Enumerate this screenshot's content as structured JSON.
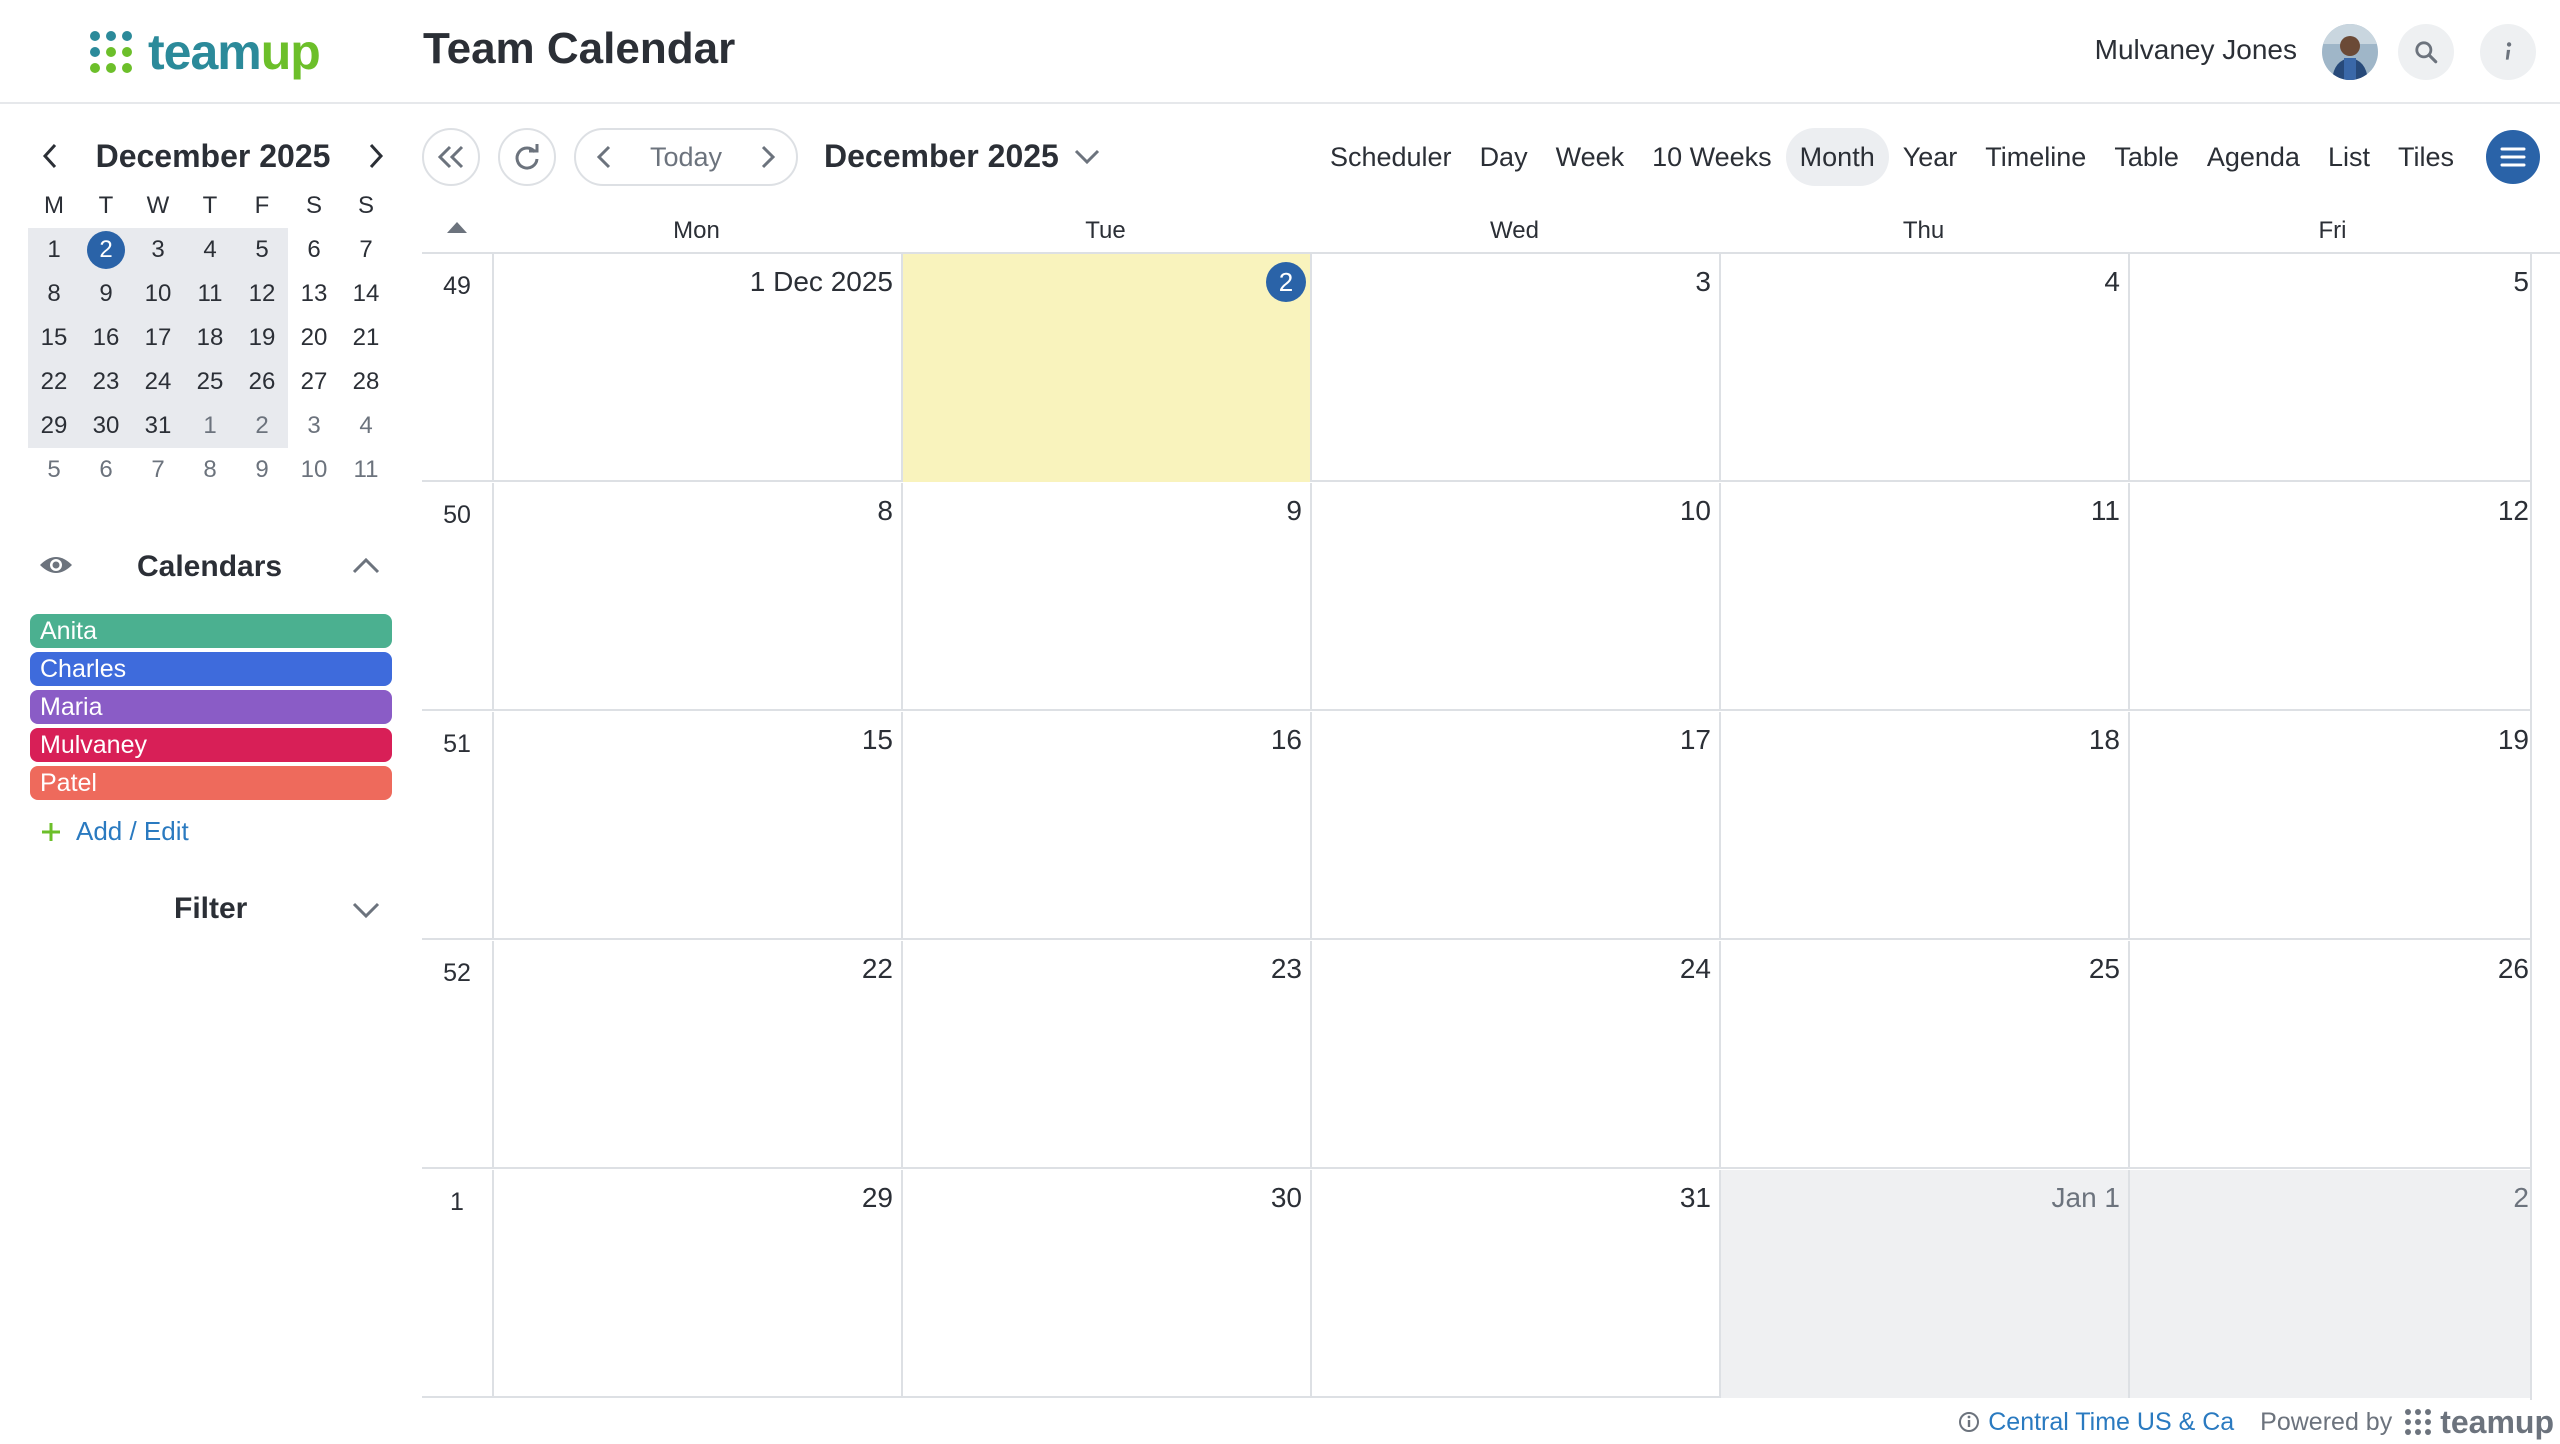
{
  "brand": {
    "name": "teamup",
    "color_team": "#2b8a9a",
    "color_up": "#6cbf2a"
  },
  "header": {
    "title": "Team Calendar",
    "user_name": "Mulvaney Jones",
    "search_icon": "search-icon",
    "info_icon": "info-icon"
  },
  "mini_calendar": {
    "title": "December 2025",
    "weekdays": [
      "M",
      "T",
      "W",
      "T",
      "F",
      "S",
      "S"
    ],
    "weeks": [
      [
        "1",
        "2",
        "3",
        "4",
        "5",
        "6",
        "7"
      ],
      [
        "8",
        "9",
        "10",
        "11",
        "12",
        "13",
        "14"
      ],
      [
        "15",
        "16",
        "17",
        "18",
        "19",
        "20",
        "21"
      ],
      [
        "22",
        "23",
        "24",
        "25",
        "26",
        "27",
        "28"
      ],
      [
        "29",
        "30",
        "31",
        "1",
        "2",
        "3",
        "4"
      ],
      [
        "5",
        "6",
        "7",
        "8",
        "9",
        "10",
        "11"
      ]
    ],
    "selected": "2"
  },
  "calendars": {
    "heading": "Calendars",
    "items": [
      {
        "label": "Anita",
        "color": "#4bb090"
      },
      {
        "label": "Charles",
        "color": "#3e6bdc"
      },
      {
        "label": "Maria",
        "color": "#8a5cc6"
      },
      {
        "label": "Mulvaney",
        "color": "#d81f57"
      },
      {
        "label": "Patel",
        "color": "#ee6a5c"
      }
    ],
    "add_edit": "Add / Edit"
  },
  "filter": {
    "heading": "Filter"
  },
  "toolbar": {
    "today_label": "Today",
    "month_label": "December 2025",
    "views": [
      "Scheduler",
      "Day",
      "Week",
      "10 Weeks",
      "Month",
      "Year",
      "Timeline",
      "Table",
      "Agenda",
      "List",
      "Tiles"
    ],
    "active_view": "Month"
  },
  "grid": {
    "weekdays": [
      "Mon",
      "Tue",
      "Wed",
      "Thu",
      "Fri"
    ],
    "weeks": [
      {
        "num": "49",
        "days": [
          "1 Dec 2025",
          "2",
          "3",
          "4",
          "5"
        ]
      },
      {
        "num": "50",
        "days": [
          "8",
          "9",
          "10",
          "11",
          "12"
        ]
      },
      {
        "num": "51",
        "days": [
          "15",
          "16",
          "17",
          "18",
          "19"
        ]
      },
      {
        "num": "52",
        "days": [
          "22",
          "23",
          "24",
          "25",
          "26"
        ]
      },
      {
        "num": "1",
        "days": [
          "29",
          "30",
          "31",
          "Jan 1",
          "2"
        ]
      }
    ],
    "today_color": "#f9f3bd"
  },
  "footer": {
    "timezone": "Central Time US & Ca",
    "powered_by": "Powered by",
    "brand": "teamup"
  }
}
